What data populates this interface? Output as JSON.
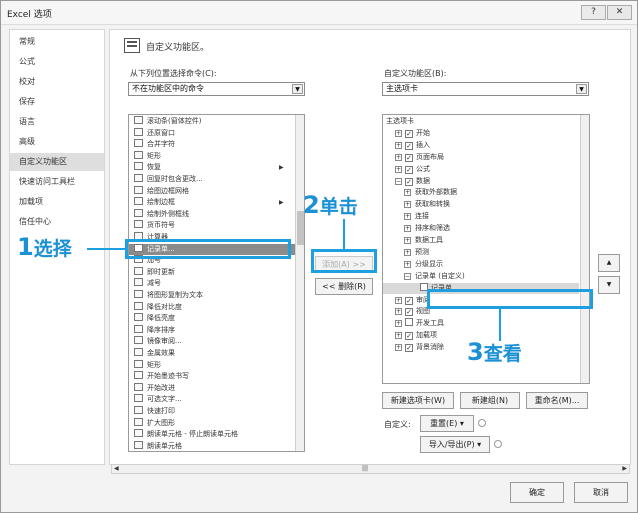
{
  "window": {
    "title": "Excel 选项",
    "help_label": "?",
    "close_label": "✕"
  },
  "sidebar": {
    "items": [
      {
        "label": "常规"
      },
      {
        "label": "公式"
      },
      {
        "label": "校对"
      },
      {
        "label": "保存"
      },
      {
        "label": "语言"
      },
      {
        "label": "高级"
      },
      {
        "label": "自定义功能区",
        "active": true
      },
      {
        "label": "快速访问工具栏"
      },
      {
        "label": "加载项"
      },
      {
        "label": "信任中心"
      }
    ]
  },
  "header": {
    "title": "自定义功能区。"
  },
  "left": {
    "label": "从下列位置选择命令(C):",
    "combo_value": "不在功能区中的命令",
    "commands": [
      "滚动条(窗体控件)",
      "还原窗口",
      "合并字符",
      "矩形",
      "恢复",
      "回复时包含更改...",
      "绘图边框网格",
      "绘制边框",
      "绘制外侧框线",
      "货币符号",
      "计算器",
      "记录单...",
      "加号",
      "即时更新",
      "减号",
      "将图形复制为文本",
      "降低对比度",
      "降低亮度",
      "降序排序",
      "镜像审阅...",
      "金属效果",
      "矩形",
      "开始墨迹书写",
      "开始改进",
      "可选文字...",
      "快速打印",
      "扩大图形",
      "朗读单元格 - 停止朗读单元格",
      "朗读单元格"
    ]
  },
  "right": {
    "label": "自定义功能区(B):",
    "combo_value": "主选项卡",
    "tree": [
      {
        "label": "主选项卡",
        "level": 0
      },
      {
        "label": "开始",
        "level": 1,
        "checked": true
      },
      {
        "label": "插入",
        "level": 1,
        "checked": true
      },
      {
        "label": "页面布局",
        "level": 1,
        "checked": true
      },
      {
        "label": "公式",
        "level": 1,
        "checked": true
      },
      {
        "label": "数据",
        "level": 1,
        "checked": true,
        "expanded": true
      },
      {
        "label": "获取外部数据",
        "level": 2
      },
      {
        "label": "获取和转换",
        "level": 2
      },
      {
        "label": "连接",
        "level": 2
      },
      {
        "label": "排序和筛选",
        "level": 2
      },
      {
        "label": "数据工具",
        "level": 2
      },
      {
        "label": "预测",
        "level": 2
      },
      {
        "label": "分级显示",
        "level": 2
      },
      {
        "label": "记录单 (自定义)",
        "level": 2,
        "expanded": true
      },
      {
        "label": "记录单",
        "level": 3,
        "selected": true
      },
      {
        "label": "审阅",
        "level": 1,
        "checked": true
      },
      {
        "label": "视图",
        "level": 1,
        "checked": true
      },
      {
        "label": "开发工具",
        "level": 1,
        "checked": false
      },
      {
        "label": "加载项",
        "level": 1,
        "checked": true
      },
      {
        "label": "背景消除",
        "level": 1,
        "checked": true
      }
    ]
  },
  "buttons": {
    "add": "添加(A) >>",
    "remove": "<< 删除(R)",
    "new_tab": "新建选项卡(W)",
    "new_group": "新建组(N)",
    "rename": "重命名(M)...",
    "customize_label": "自定义:",
    "reset": "重置(E) ▾",
    "import_export": "导入/导出(P) ▾",
    "ok": "确定",
    "cancel": "取消",
    "move_up": "▲",
    "move_down": "▼"
  },
  "annotations": {
    "step1_num": "1",
    "step1_text": "选择",
    "step2_num": "2",
    "step2_text": "单击",
    "step3_num": "3",
    "step3_text": "查看",
    "accent": "#1ea0e0"
  }
}
